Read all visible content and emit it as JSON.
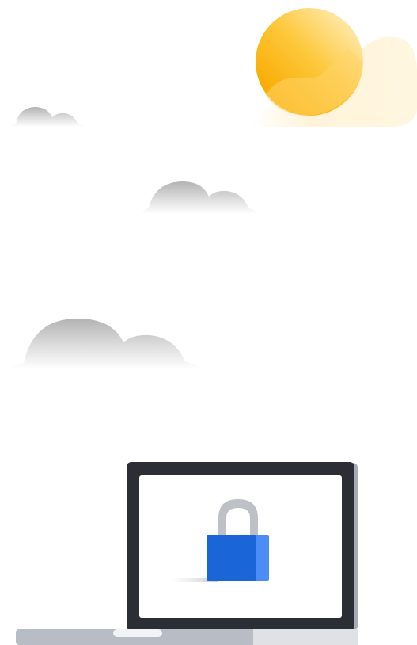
{
  "illustration": {
    "subject": "laptop-with-padlock",
    "elements": [
      "sun-icon",
      "cloud-icon",
      "cloud-icon",
      "cloud-icon",
      "laptop-icon",
      "lock-icon"
    ]
  },
  "colors": {
    "background": "#ffffff",
    "sun_light": "#ffe7a3",
    "sun_mid": "#fdc93e",
    "sun_dark": "#f9ab00",
    "sun_glow": "#fff3d6",
    "cloud_top": "#bdbdbd",
    "cloud_bottom": "#ffffff",
    "laptop_bezel": "#2b2e35",
    "laptop_bezel_shadow": "#a7acb4",
    "laptop_screen": "#ffffff",
    "laptop_base_left": "#b8bdc5",
    "laptop_base_right": "#dfe1e5",
    "laptop_notch": "#f1f3f4",
    "lock_shackle": "#bdc1c6",
    "lock_body": "#1a66d9",
    "lock_body_side": "#4c8df5",
    "lock_shadow": "#dadce0"
  }
}
